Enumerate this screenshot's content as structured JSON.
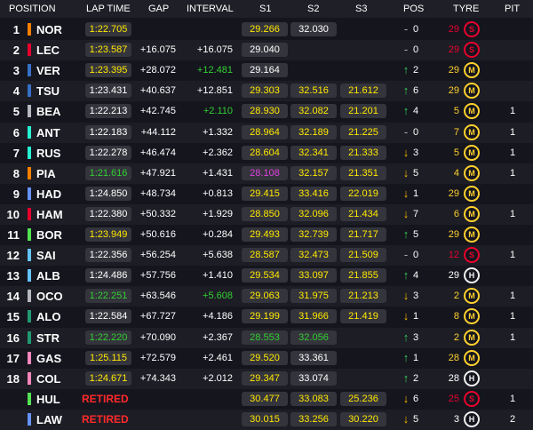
{
  "header": {
    "position": "POSITION",
    "lap_time": "LAP TIME",
    "gap": "GAP",
    "interval": "INTERVAL",
    "s1": "S1",
    "s2": "S2",
    "s3": "S3",
    "pos": "POS",
    "tyre": "TYRE",
    "pit": "PIT"
  },
  "colors": {
    "yellow": "#ffe900",
    "green": "#32d132",
    "purple": "#e040e0",
    "soft": "#e8002d",
    "medium": "#ffd12e",
    "hard": "#f0f0f0",
    "retired": "#ff2a2a",
    "gain": "#33d05a",
    "loss": "#f5b800"
  },
  "rows": [
    {
      "pos": "1",
      "team": "#ff8000",
      "driver": "NOR",
      "lap": "1:22.705",
      "lap_c": "yel",
      "gap": "",
      "int": "",
      "s1": "29.266",
      "s1_c": "yel",
      "s2": "32.030",
      "s2_c": "wht",
      "s3": "",
      "s3_c": "",
      "dir": "same",
      "chg": "0",
      "age": "29",
      "age_c": "red",
      "tyre": "S",
      "tyre_color": "#e8002d",
      "pit": "",
      "retired": ""
    },
    {
      "pos": "2",
      "team": "#e8002d",
      "driver": "LEC",
      "lap": "1:23.587",
      "lap_c": "yel",
      "gap": "+16.075",
      "gap_c": "wht",
      "int": "+16.075",
      "int_c": "wht",
      "s1": "29.040",
      "s1_c": "wht",
      "s2": "",
      "s2_c": "",
      "s3": "",
      "s3_c": "",
      "dir": "same",
      "chg": "0",
      "age": "29",
      "age_c": "red",
      "tyre": "S",
      "tyre_color": "#e8002d",
      "pit": "",
      "retired": ""
    },
    {
      "pos": "3",
      "team": "#3671c6",
      "driver": "VER",
      "lap": "1:23.395",
      "lap_c": "yel",
      "gap": "+28.072",
      "gap_c": "wht",
      "int": "+12.481",
      "int_c": "grn",
      "s1": "29.164",
      "s1_c": "wht",
      "s2": "",
      "s2_c": "",
      "s3": "",
      "s3_c": "",
      "dir": "up",
      "chg": "2",
      "age": "29",
      "age_c": "yel",
      "tyre": "M",
      "tyre_color": "#ffd12e",
      "pit": "",
      "retired": ""
    },
    {
      "pos": "4",
      "team": "#3671c6",
      "driver": "TSU",
      "lap": "1:23.431",
      "lap_c": "wht",
      "gap": "+40.637",
      "gap_c": "wht",
      "int": "+12.851",
      "int_c": "wht",
      "s1": "29.303",
      "s1_c": "yel",
      "s2": "32.516",
      "s2_c": "yel",
      "s3": "21.612",
      "s3_c": "yel",
      "dir": "up",
      "chg": "6",
      "age": "29",
      "age_c": "yel",
      "tyre": "M",
      "tyre_color": "#ffd12e",
      "pit": "",
      "retired": ""
    },
    {
      "pos": "5",
      "team": "#b6babd",
      "driver": "BEA",
      "lap": "1:22.213",
      "lap_c": "wht",
      "gap": "+42.745",
      "gap_c": "wht",
      "int": "+2.110",
      "int_c": "grn",
      "s1": "28.930",
      "s1_c": "yel",
      "s2": "32.082",
      "s2_c": "yel",
      "s3": "21.201",
      "s3_c": "yel",
      "dir": "up",
      "chg": "4",
      "age": "5",
      "age_c": "yel",
      "tyre": "M",
      "tyre_color": "#ffd12e",
      "pit": "1",
      "retired": ""
    },
    {
      "pos": "6",
      "team": "#27f4d2",
      "driver": "ANT",
      "lap": "1:22.183",
      "lap_c": "wht",
      "gap": "+44.112",
      "gap_c": "wht",
      "int": "+1.332",
      "int_c": "wht",
      "s1": "28.964",
      "s1_c": "yel",
      "s2": "32.189",
      "s2_c": "yel",
      "s3": "21.225",
      "s3_c": "yel",
      "dir": "same",
      "chg": "0",
      "age": "7",
      "age_c": "yel",
      "tyre": "M",
      "tyre_color": "#ffd12e",
      "pit": "1",
      "retired": ""
    },
    {
      "pos": "7",
      "team": "#27f4d2",
      "driver": "RUS",
      "lap": "1:22.278",
      "lap_c": "wht",
      "gap": "+46.474",
      "gap_c": "wht",
      "int": "+2.362",
      "int_c": "wht",
      "s1": "28.604",
      "s1_c": "yel",
      "s2": "32.341",
      "s2_c": "yel",
      "s3": "21.333",
      "s3_c": "yel",
      "dir": "down",
      "chg": "3",
      "age": "5",
      "age_c": "yel",
      "tyre": "M",
      "tyre_color": "#ffd12e",
      "pit": "1",
      "retired": ""
    },
    {
      "pos": "8",
      "team": "#ff8000",
      "driver": "PIA",
      "lap": "1:21.616",
      "lap_c": "grn",
      "gap": "+47.921",
      "gap_c": "wht",
      "int": "+1.431",
      "int_c": "wht",
      "s1": "28.108",
      "s1_c": "pur",
      "s2": "32.157",
      "s2_c": "yel",
      "s3": "21.351",
      "s3_c": "yel",
      "dir": "down",
      "chg": "5",
      "age": "4",
      "age_c": "yel",
      "tyre": "M",
      "tyre_color": "#ffd12e",
      "pit": "1",
      "retired": ""
    },
    {
      "pos": "9",
      "team": "#6692ff",
      "driver": "HAD",
      "lap": "1:24.850",
      "lap_c": "wht",
      "gap": "+48.734",
      "gap_c": "wht",
      "int": "+0.813",
      "int_c": "wht",
      "s1": "29.415",
      "s1_c": "yel",
      "s2": "33.416",
      "s2_c": "yel",
      "s3": "22.019",
      "s3_c": "yel",
      "dir": "down",
      "chg": "1",
      "age": "29",
      "age_c": "yel",
      "tyre": "M",
      "tyre_color": "#ffd12e",
      "pit": "",
      "retired": ""
    },
    {
      "pos": "10",
      "team": "#e8002d",
      "driver": "HAM",
      "lap": "1:22.380",
      "lap_c": "wht",
      "gap": "+50.332",
      "gap_c": "wht",
      "int": "+1.929",
      "int_c": "wht",
      "s1": "28.850",
      "s1_c": "yel",
      "s2": "32.096",
      "s2_c": "yel",
      "s3": "21.434",
      "s3_c": "yel",
      "dir": "down",
      "chg": "7",
      "age": "6",
      "age_c": "yel",
      "tyre": "M",
      "tyre_color": "#ffd12e",
      "pit": "1",
      "retired": ""
    },
    {
      "pos": "11",
      "team": "#52e252",
      "driver": "BOR",
      "lap": "1:23.949",
      "lap_c": "yel",
      "gap": "+50.616",
      "gap_c": "wht",
      "int": "+0.284",
      "int_c": "wht",
      "s1": "29.493",
      "s1_c": "yel",
      "s2": "32.739",
      "s2_c": "yel",
      "s3": "21.717",
      "s3_c": "yel",
      "dir": "up",
      "chg": "5",
      "age": "29",
      "age_c": "yel",
      "tyre": "M",
      "tyre_color": "#ffd12e",
      "pit": "",
      "retired": ""
    },
    {
      "pos": "12",
      "team": "#64c4ff",
      "driver": "SAI",
      "lap": "1:22.356",
      "lap_c": "wht",
      "gap": "+56.254",
      "gap_c": "wht",
      "int": "+5.638",
      "int_c": "wht",
      "s1": "28.587",
      "s1_c": "yel",
      "s2": "32.473",
      "s2_c": "yel",
      "s3": "21.509",
      "s3_c": "yel",
      "dir": "same",
      "chg": "0",
      "age": "12",
      "age_c": "red",
      "tyre": "S",
      "tyre_color": "#e8002d",
      "pit": "1",
      "retired": ""
    },
    {
      "pos": "13",
      "team": "#64c4ff",
      "driver": "ALB",
      "lap": "1:24.486",
      "lap_c": "wht",
      "gap": "+57.756",
      "gap_c": "wht",
      "int": "+1.410",
      "int_c": "wht",
      "s1": "29.534",
      "s1_c": "yel",
      "s2": "33.097",
      "s2_c": "yel",
      "s3": "21.855",
      "s3_c": "yel",
      "dir": "up",
      "chg": "4",
      "age": "29",
      "age_c": "wht",
      "tyre": "H",
      "tyre_color": "#f0f0f0",
      "pit": "",
      "retired": ""
    },
    {
      "pos": "14",
      "team": "#b6babd",
      "driver": "OCO",
      "lap": "1:22.251",
      "lap_c": "grn",
      "gap": "+63.546",
      "gap_c": "wht",
      "int": "+5.608",
      "int_c": "grn",
      "s1": "29.063",
      "s1_c": "yel",
      "s2": "31.975",
      "s2_c": "yel",
      "s3": "21.213",
      "s3_c": "yel",
      "dir": "down",
      "chg": "3",
      "age": "2",
      "age_c": "yel",
      "tyre": "M",
      "tyre_color": "#ffd12e",
      "pit": "1",
      "retired": ""
    },
    {
      "pos": "15",
      "team": "#229971",
      "driver": "ALO",
      "lap": "1:22.584",
      "lap_c": "wht",
      "gap": "+67.727",
      "gap_c": "wht",
      "int": "+4.186",
      "int_c": "wht",
      "s1": "29.199",
      "s1_c": "yel",
      "s2": "31.966",
      "s2_c": "yel",
      "s3": "21.419",
      "s3_c": "yel",
      "dir": "down",
      "chg": "1",
      "age": "8",
      "age_c": "yel",
      "tyre": "M",
      "tyre_color": "#ffd12e",
      "pit": "1",
      "retired": ""
    },
    {
      "pos": "16",
      "team": "#229971",
      "driver": "STR",
      "lap": "1:22.220",
      "lap_c": "grn",
      "gap": "+70.090",
      "gap_c": "wht",
      "int": "+2.367",
      "int_c": "wht",
      "s1": "28.553",
      "s1_c": "grn",
      "s2": "32.056",
      "s2_c": "grn",
      "s3": "",
      "s3_c": "",
      "dir": "up",
      "chg": "3",
      "age": "2",
      "age_c": "yel",
      "tyre": "M",
      "tyre_color": "#ffd12e",
      "pit": "1",
      "retired": ""
    },
    {
      "pos": "17",
      "team": "#ff87bc",
      "driver": "GAS",
      "lap": "1:25.115",
      "lap_c": "yel",
      "gap": "+72.579",
      "gap_c": "wht",
      "int": "+2.461",
      "int_c": "wht",
      "s1": "29.520",
      "s1_c": "yel",
      "s2": "33.361",
      "s2_c": "wht",
      "s3": "",
      "s3_c": "",
      "dir": "up",
      "chg": "1",
      "age": "28",
      "age_c": "yel",
      "tyre": "M",
      "tyre_color": "#ffd12e",
      "pit": "",
      "retired": ""
    },
    {
      "pos": "18",
      "team": "#ff87bc",
      "driver": "COL",
      "lap": "1:24.671",
      "lap_c": "yel",
      "gap": "+74.343",
      "gap_c": "wht",
      "int": "+2.012",
      "int_c": "wht",
      "s1": "29.347",
      "s1_c": "yel",
      "s2": "33.074",
      "s2_c": "wht",
      "s3": "",
      "s3_c": "",
      "dir": "up",
      "chg": "2",
      "age": "28",
      "age_c": "wht",
      "tyre": "H",
      "tyre_color": "#f0f0f0",
      "pit": "",
      "retired": ""
    },
    {
      "pos": "",
      "team": "#52e252",
      "driver": "HUL",
      "lap": "",
      "lap_c": "",
      "gap": "",
      "int": "",
      "s1": "30.477",
      "s1_c": "yel",
      "s2": "33.083",
      "s2_c": "yel",
      "s3": "25.236",
      "s3_c": "yel",
      "dir": "down",
      "chg": "6",
      "age": "25",
      "age_c": "red",
      "tyre": "S",
      "tyre_color": "#e8002d",
      "pit": "1",
      "retired": "RETIRED"
    },
    {
      "pos": "",
      "team": "#6692ff",
      "driver": "LAW",
      "lap": "",
      "lap_c": "",
      "gap": "",
      "int": "",
      "s1": "30.015",
      "s1_c": "yel",
      "s2": "33.256",
      "s2_c": "yel",
      "s3": "30.220",
      "s3_c": "yel",
      "dir": "down",
      "chg": "5",
      "age": "3",
      "age_c": "wht",
      "tyre": "H",
      "tyre_color": "#f0f0f0",
      "pit": "2",
      "retired": "RETIRED"
    }
  ]
}
